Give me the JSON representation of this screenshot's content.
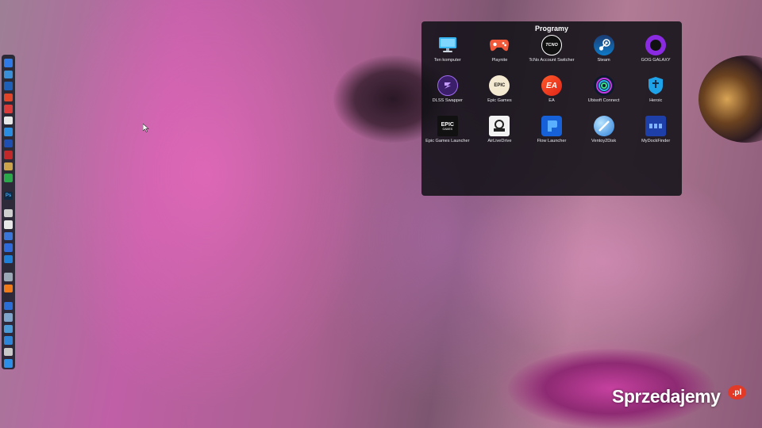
{
  "panel": {
    "title": "Programy",
    "apps": [
      {
        "label": "Ten komputer",
        "icon": "monitor-icon"
      },
      {
        "label": "Playnite",
        "icon": "gamepad-icon"
      },
      {
        "label": "TcNo Account Switcher",
        "icon": "tcno-icon",
        "icon_text": "TCNO"
      },
      {
        "label": "Steam",
        "icon": "steam-icon"
      },
      {
        "label": "GOG GALAXY",
        "icon": "gog-galaxy-icon"
      },
      {
        "label": "DLSS Swapper",
        "icon": "dlss-swapper-icon"
      },
      {
        "label": "Epic Games",
        "icon": "epic-games-icon",
        "icon_text": "EPIC"
      },
      {
        "label": "EA",
        "icon": "ea-icon",
        "icon_text": "EA"
      },
      {
        "label": "Ubisoft Connect",
        "icon": "ubisoft-icon"
      },
      {
        "label": "Heroic",
        "icon": "heroic-icon"
      },
      {
        "label": "Epic Games Launcher",
        "icon": "epic-games-launcher-icon",
        "icon_text": "EPIC",
        "icon_subtext": "GAMES"
      },
      {
        "label": "AirLiveDrive",
        "icon": "airlivedrive-icon"
      },
      {
        "label": "Flow Launcher",
        "icon": "flow-launcher-icon"
      },
      {
        "label": "Ventoy2Disk",
        "icon": "ventoy-icon"
      },
      {
        "label": "MyDockFinder",
        "icon": "mydockfinder-icon"
      }
    ]
  },
  "dock": {
    "items": [
      {
        "icon": "finder-icon",
        "color": "#2f7ae5"
      },
      {
        "icon": "window-icon",
        "color": "#3a8fd6"
      },
      {
        "icon": "rocket-icon",
        "color": "#1e5fb8"
      },
      {
        "icon": "brave-icon",
        "color": "#e0452a"
      },
      {
        "icon": "vivaldi-icon",
        "color": "#d93a3a"
      },
      {
        "icon": "notes-icon",
        "color": "#e8e8e8"
      },
      {
        "icon": "settings-icon",
        "color": "#2b8de0"
      },
      {
        "icon": "shield-icon",
        "color": "#1f4fb0"
      },
      {
        "icon": "red-app-icon",
        "color": "#c0282a"
      },
      {
        "icon": "image-icon",
        "color": "#caa34a"
      },
      {
        "icon": "lock-icon",
        "color": "#2aa84a"
      },
      {
        "icon": "photoshop-icon",
        "color": "#0f2a44",
        "text": "Ps"
      },
      {
        "icon": "tool-icon",
        "color": "#cfcfcf"
      },
      {
        "icon": "steam-dock-icon",
        "color": "#e8e8e8"
      },
      {
        "icon": "nord-icon",
        "color": "#3a76d8"
      },
      {
        "icon": "cross-icon",
        "color": "#2e6ad9"
      },
      {
        "icon": "globe-icon",
        "color": "#1f7fd6"
      },
      {
        "icon": "terminal-icon",
        "color": "#9aa7b5"
      },
      {
        "icon": "browser-icon",
        "color": "#f07a1a"
      },
      {
        "icon": "edit-icon",
        "color": "#2b6fd6"
      },
      {
        "icon": "paste-icon",
        "color": "#7fa4cc"
      },
      {
        "icon": "cast-icon",
        "color": "#4a9ad8"
      },
      {
        "icon": "box-icon",
        "color": "#2f86d9"
      },
      {
        "icon": "drive-icon",
        "color": "#c9c9c9"
      },
      {
        "icon": "download-icon",
        "color": "#2e8fe6"
      }
    ]
  },
  "watermark": {
    "text": "Sprzedajemy",
    "badge": ".pl"
  }
}
